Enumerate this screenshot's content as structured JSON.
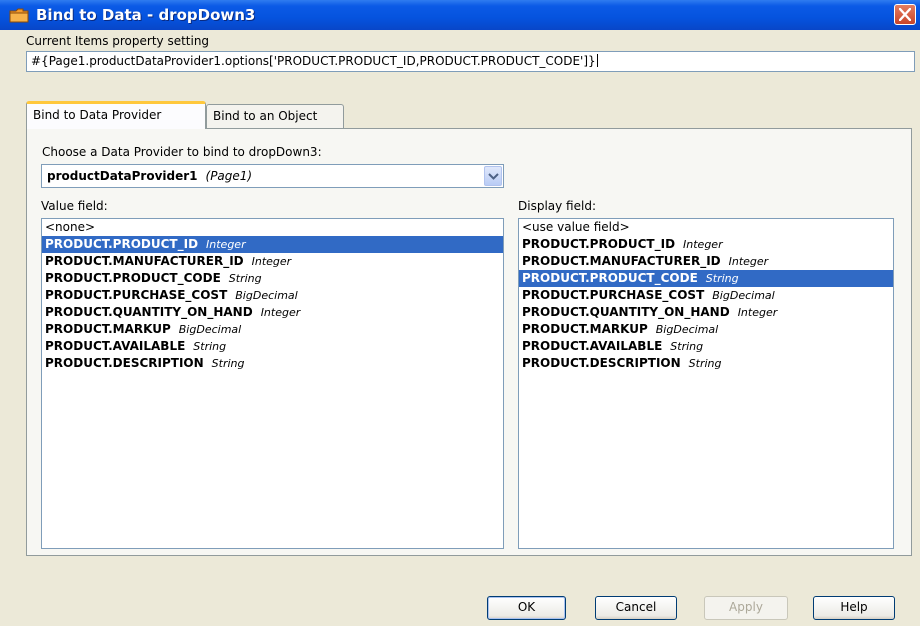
{
  "window": {
    "title": "Bind to Data - dropDown3",
    "colors": {
      "titlebar": "#0553de",
      "selection": "#316ac5",
      "tab_highlight": "#ffc83c"
    }
  },
  "current_setting": {
    "label": "Current Items property setting",
    "value": "#{Page1.productDataProvider1.options['PRODUCT.PRODUCT_ID,PRODUCT.PRODUCT_CODE']}"
  },
  "tabs": [
    {
      "label": "Bind to Data Provider",
      "active": true
    },
    {
      "label": "Bind to an Object",
      "active": false
    }
  ],
  "provider": {
    "label": "Choose a Data Provider to bind to dropDown3:",
    "selected_name": "productDataProvider1",
    "selected_scope": "(Page1)"
  },
  "value_field": {
    "label": "Value field:",
    "placeholder": "<none>",
    "items": [
      {
        "name": "PRODUCT.PRODUCT_ID",
        "type": "Integer"
      },
      {
        "name": "PRODUCT.MANUFACTURER_ID",
        "type": "Integer"
      },
      {
        "name": "PRODUCT.PRODUCT_CODE",
        "type": "String"
      },
      {
        "name": "PRODUCT.PURCHASE_COST",
        "type": "BigDecimal"
      },
      {
        "name": "PRODUCT.QUANTITY_ON_HAND",
        "type": "Integer"
      },
      {
        "name": "PRODUCT.MARKUP",
        "type": "BigDecimal"
      },
      {
        "name": "PRODUCT.AVAILABLE",
        "type": "String"
      },
      {
        "name": "PRODUCT.DESCRIPTION",
        "type": "String"
      }
    ]
  },
  "display_field": {
    "label": "Display field:",
    "placeholder": "<use value field>",
    "items": [
      {
        "name": "PRODUCT.PRODUCT_ID",
        "type": "Integer"
      },
      {
        "name": "PRODUCT.MANUFACTURER_ID",
        "type": "Integer"
      },
      {
        "name": "PRODUCT.PRODUCT_CODE",
        "type": "String"
      },
      {
        "name": "PRODUCT.PURCHASE_COST",
        "type": "BigDecimal"
      },
      {
        "name": "PRODUCT.QUANTITY_ON_HAND",
        "type": "Integer"
      },
      {
        "name": "PRODUCT.MARKUP",
        "type": "BigDecimal"
      },
      {
        "name": "PRODUCT.AVAILABLE",
        "type": "String"
      },
      {
        "name": "PRODUCT.DESCRIPTION",
        "type": "String"
      }
    ]
  },
  "buttons": {
    "ok": "OK",
    "cancel": "Cancel",
    "apply": "Apply",
    "help": "Help"
  },
  "icons": {
    "app": "folder-icon",
    "close": "close-icon",
    "dropdown": "chevron-down-icon"
  }
}
